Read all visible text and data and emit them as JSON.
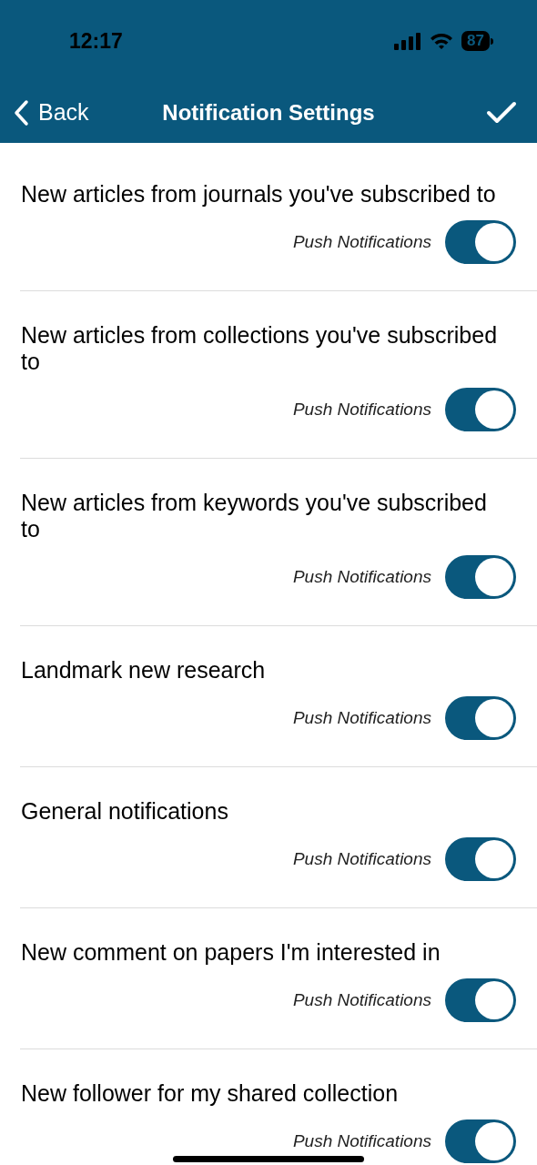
{
  "status_bar": {
    "time": "12:17",
    "battery": "87"
  },
  "nav": {
    "back": "Back",
    "title": "Notification Settings"
  },
  "settings": [
    {
      "title": "New articles from journals you've subscribed to",
      "label": "Push Notifications",
      "on": true
    },
    {
      "title": "New articles from collections you've subscribed to",
      "label": "Push Notifications",
      "on": true
    },
    {
      "title": "New articles from keywords you've subscribed to",
      "label": "Push Notifications",
      "on": true
    },
    {
      "title": "Landmark new research",
      "label": "Push Notifications",
      "on": true
    },
    {
      "title": "General notifications",
      "label": "Push Notifications",
      "on": true
    },
    {
      "title": "New comment on papers I'm interested in",
      "label": "Push Notifications",
      "on": true
    },
    {
      "title": "New follower for my shared collection",
      "label": "Push Notifications",
      "on": true
    }
  ]
}
